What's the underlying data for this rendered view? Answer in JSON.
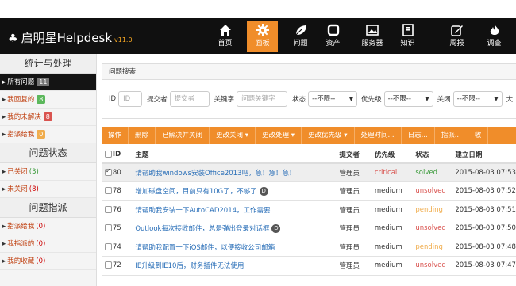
{
  "app": {
    "title": "启明星Helpdesk",
    "version": "v11.0"
  },
  "nav": [
    {
      "label": "首页",
      "icon": "home-icon"
    },
    {
      "label": "面板",
      "icon": "gear-icon",
      "active": true
    },
    {
      "label": "问题",
      "icon": "leaf-icon"
    },
    {
      "label": "资产",
      "icon": "square-icon"
    },
    {
      "label": "服务器",
      "icon": "image-icon"
    },
    {
      "label": "知识",
      "icon": "book-icon"
    },
    {
      "label": "周报",
      "icon": "edit-icon"
    },
    {
      "label": "调查",
      "icon": "fire-icon"
    }
  ],
  "sidebar": {
    "stats_heading": "统计与处理",
    "stats_items": [
      {
        "label": "所有问题",
        "badge": "11",
        "badge_color": "#777777",
        "active": true
      },
      {
        "label": "我回复的",
        "badge": "8",
        "badge_color": "#5cb85c"
      },
      {
        "label": "我的未解决",
        "badge": "8",
        "badge_color": "#d9534f"
      },
      {
        "label": "指派给我",
        "badge": "0",
        "badge_color": "#f0ad4e"
      }
    ],
    "status_heading": "问题状态",
    "status_items": [
      {
        "label": "已关闭",
        "count": "(3)",
        "color": "green"
      },
      {
        "label": "未关闭",
        "count": "(8)",
        "color": "red"
      }
    ],
    "assign_heading": "问题指派",
    "assign_items": [
      {
        "label": "指派给我",
        "count": "(0)"
      },
      {
        "label": "我指派的",
        "count": "(0)"
      },
      {
        "label": "我的收藏",
        "count": "(0)"
      }
    ]
  },
  "search": {
    "title": "问题搜索",
    "id_label": "ID",
    "id_placeholder": "ID",
    "submitter_label": "提交者",
    "submitter_placeholder": "提交者",
    "keyword_label": "关键字",
    "keyword_placeholder": "问题关键字",
    "status_label": "状态",
    "status_value": "--不限--",
    "priority_label": "优先级",
    "priority_value": "--不限--",
    "closed_label": "关闭",
    "closed_value": "--不限--",
    "trailing_label": "大"
  },
  "toolbar": [
    "操作",
    "删除",
    "已解决并关闭",
    "更改关闭 ▾",
    "更改处理 ▾",
    "更改优先级 ▾",
    "处理时间...",
    "日志...",
    "指派...",
    "收"
  ],
  "table": {
    "headers": [
      "ID",
      "主题",
      "提交者",
      "优先级",
      "状态",
      "建立日期"
    ],
    "rows": [
      {
        "id": "80",
        "subject": "请帮助我windows安装Office2013吧，急！急！急！",
        "d": false,
        "submitter": "管理员",
        "priority": "critical",
        "status": "solved",
        "date": "2015-08-03 07:53",
        "checked": true
      },
      {
        "id": "78",
        "subject": "增加磁盘空间，目前只有10G了，不够了",
        "d": true,
        "submitter": "管理员",
        "priority": "medium",
        "status": "unsolved",
        "date": "2015-08-03 07:52",
        "checked": false
      },
      {
        "id": "76",
        "subject": "请帮助我安装一下AutoCAD2014，工作需要",
        "d": false,
        "submitter": "管理员",
        "priority": "medium",
        "status": "pending",
        "date": "2015-08-03 07:51",
        "checked": false
      },
      {
        "id": "75",
        "subject": "Outlook每次接收邮件，总是弹出登录对话框",
        "d": true,
        "submitter": "管理员",
        "priority": "medium",
        "status": "unsolved",
        "date": "2015-08-03 07:50",
        "checked": false
      },
      {
        "id": "74",
        "subject": "请帮助我配置一下iOS邮件，以便接收公司邮箱",
        "d": false,
        "submitter": "管理员",
        "priority": "medium",
        "status": "pending",
        "date": "2015-08-03 07:48",
        "checked": false
      },
      {
        "id": "72",
        "subject": "IE升级到IE10后，财务插件无法使用",
        "d": false,
        "submitter": "管理员",
        "priority": "medium",
        "status": "unsolved",
        "date": "2015-08-03 07:47",
        "checked": false
      }
    ]
  },
  "colors": {
    "accent": "#f08d2a",
    "navbar": "#101010",
    "critical": "#d9534f",
    "solved": "#3a9a3a",
    "unsolved": "#d9534f",
    "pending": "#f0ad4e",
    "link": "#2a6fb8"
  }
}
